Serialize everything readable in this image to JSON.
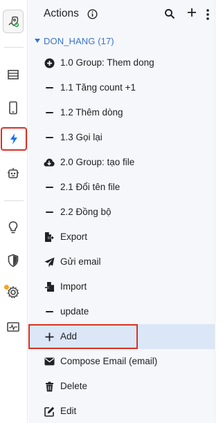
{
  "panel": {
    "title": "Actions",
    "group": {
      "label": "DON_HANG (17)",
      "expanded": true
    },
    "items": [
      {
        "label": "1.0 Group: Them dong",
        "icon": "add-circle-icon"
      },
      {
        "label": "1.1 Tăng count +1",
        "icon": "dash-icon"
      },
      {
        "label": "1.2 Thêm dòng",
        "icon": "dash-icon"
      },
      {
        "label": "1.3 Gọi lại",
        "icon": "dash-icon"
      },
      {
        "label": "2.0 Group: tạo file",
        "icon": "cloud-download-icon"
      },
      {
        "label": "2.1 Đổi tên file",
        "icon": "dash-icon"
      },
      {
        "label": "2.2 Đồng bộ",
        "icon": "dash-icon"
      },
      {
        "label": "Export",
        "icon": "file-export-icon"
      },
      {
        "label": "Gửi email",
        "icon": "send-icon"
      },
      {
        "label": "Import",
        "icon": "file-import-icon"
      },
      {
        "label": "update",
        "icon": "dash-icon"
      },
      {
        "label": "Add",
        "icon": "plus-icon",
        "selected": true
      },
      {
        "label": "Compose Email (email)",
        "icon": "envelope-icon"
      },
      {
        "label": "Delete",
        "icon": "trash-icon"
      },
      {
        "label": "Edit",
        "icon": "edit-icon"
      }
    ]
  },
  "rail": {
    "items": [
      "logo-icon",
      "table-icon",
      "phone-icon",
      "bolt-icon",
      "robot-icon",
      "lightbulb-icon",
      "shield-icon",
      "gear-icon",
      "monitor-icon"
    ],
    "active": "bolt-icon"
  },
  "colors": {
    "accent": "#3a73c9",
    "highlight": "#d93025",
    "selected_bg": "#dbe6f7",
    "panel_bg": "#f5f7fa"
  }
}
